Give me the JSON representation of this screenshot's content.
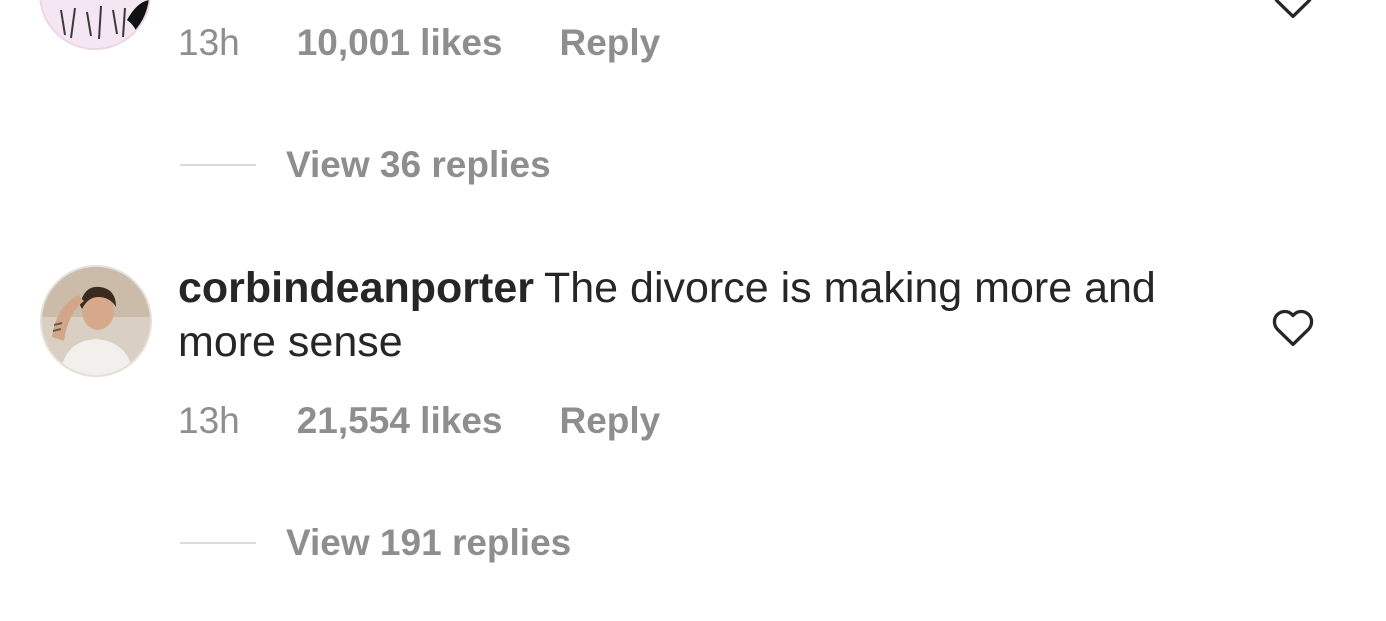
{
  "comments": [
    {
      "time": "13h",
      "likes": "10,001 likes",
      "reply_label": "Reply",
      "view_replies": "View 36 replies"
    },
    {
      "username": "corbindeanporter",
      "text": "The divorce is making more and more sense",
      "time": "13h",
      "likes": "21,554 likes",
      "reply_label": "Reply",
      "view_replies": "View 191 replies"
    }
  ],
  "colors": {
    "primary_text": "#262626",
    "secondary_text": "#8e8e8e",
    "divider": "#dbdbdb"
  },
  "icons": {
    "like": "heart-outline-icon"
  }
}
